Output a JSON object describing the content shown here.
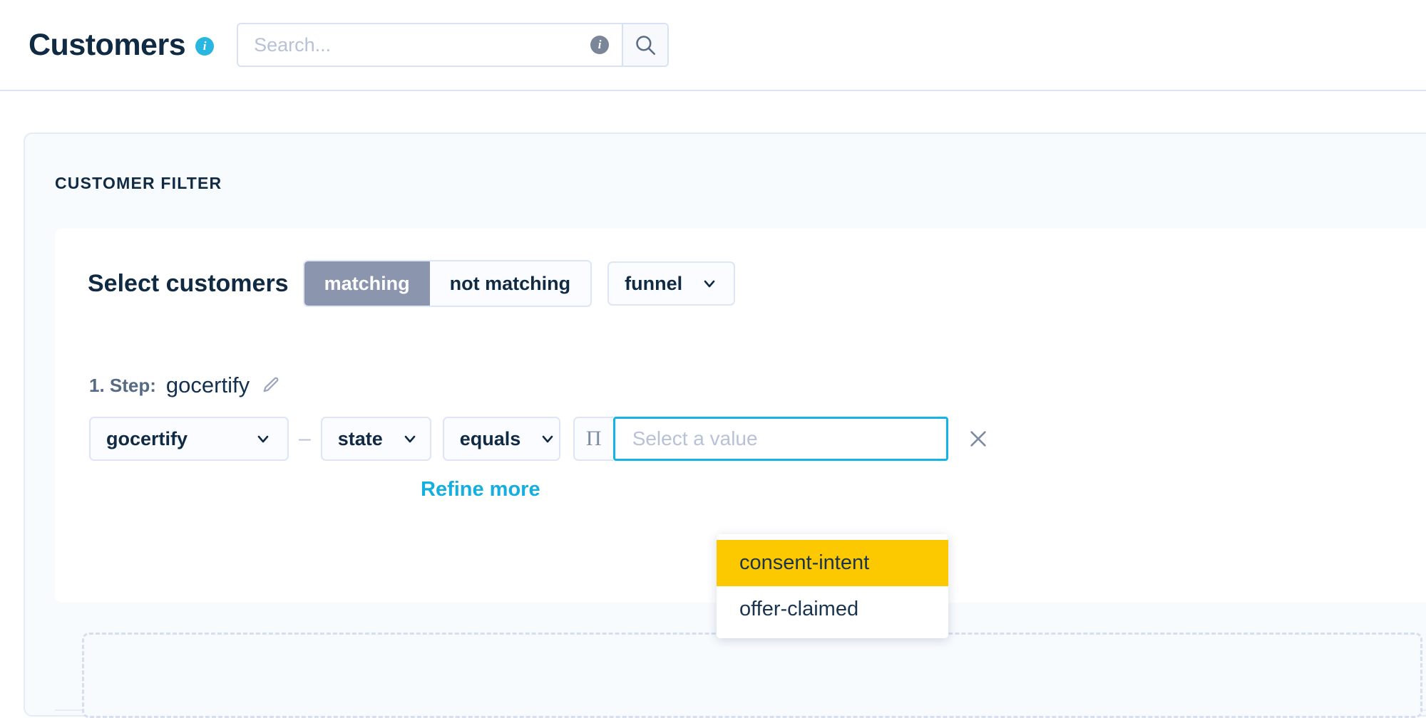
{
  "header": {
    "title": "Customers",
    "title_info_icon": "info-icon",
    "title_info_glyph": "i",
    "search": {
      "placeholder": "Search...",
      "value": "",
      "info_icon": "info-icon",
      "info_glyph": "i",
      "search_icon": "search-icon"
    }
  },
  "filter_card": {
    "title": "CUSTOMER FILTER",
    "select_customers": {
      "label": "Select customers",
      "segmented": [
        {
          "label": "matching",
          "active": true
        },
        {
          "label": "not matching",
          "active": false
        }
      ],
      "type_dropdown": {
        "value": "funnel",
        "chevron_icon": "chevron-down-icon"
      }
    },
    "step": {
      "index_label": "1. Step:",
      "name": "gocertify",
      "edit_icon": "pencil-icon"
    },
    "condition": {
      "source": {
        "value": "gocertify",
        "chevron_icon": "chevron-down-icon"
      },
      "separator": "–",
      "field": {
        "value": "state",
        "chevron_icon": "chevron-down-icon"
      },
      "operator": {
        "value": "equals",
        "chevron_icon": "chevron-down-icon"
      },
      "pi_button": {
        "glyph": "Π",
        "icon": "pi-icon"
      },
      "value_input": {
        "placeholder": "Select a value",
        "value": ""
      },
      "remove_icon": "close-icon"
    },
    "refine_more": "Refine more",
    "suggestions": [
      {
        "label": "consent-intent",
        "highlighted": true
      },
      {
        "label": "offer-claimed",
        "highlighted": false
      }
    ]
  },
  "colors": {
    "accent_cyan": "#13b5e8",
    "highlight_yellow": "#fcc900",
    "segment_active": "#8b95ae",
    "title_navy": "#102a43"
  }
}
